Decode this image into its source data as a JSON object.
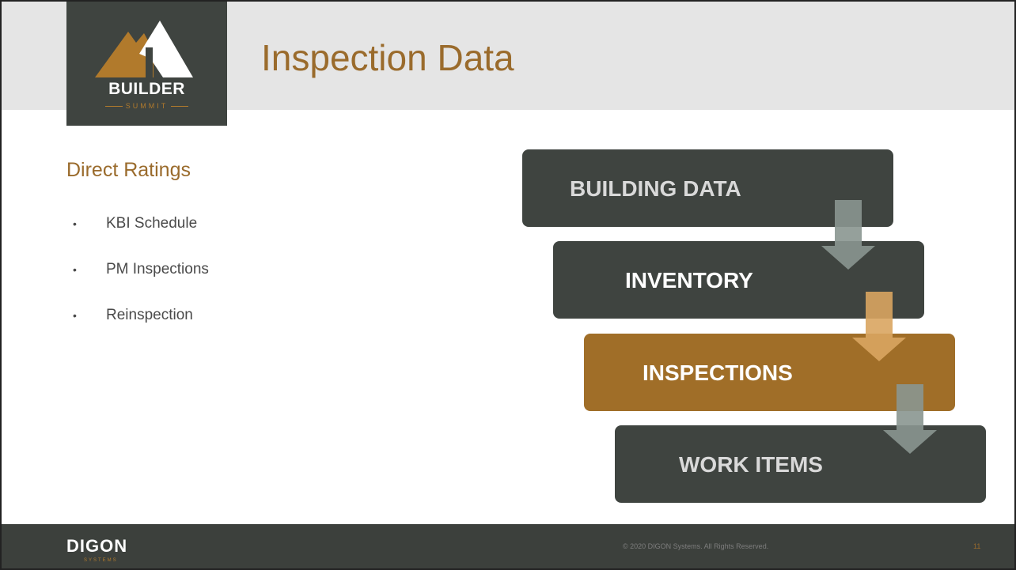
{
  "header": {
    "title": "Inspection Data",
    "logo_word": "BUILDER",
    "logo_sub": "SUMMIT"
  },
  "content": {
    "heading": "Direct Ratings",
    "bullets": [
      "KBI Schedule",
      "PM Inspections",
      "Reinspection"
    ]
  },
  "flow": {
    "steps": [
      {
        "label": "BUILDING DATA",
        "box_color": "#3f4440",
        "text_color": "#d9d9d9"
      },
      {
        "label": "INVENTORY",
        "box_color": "#3f4440",
        "text_color": "#ffffff"
      },
      {
        "label": "INSPECTIONS",
        "box_color": "#a06e28",
        "text_color": "#ffffff"
      },
      {
        "label": "WORK ITEMS",
        "box_color": "#3f4440",
        "text_color": "#d9d9d9"
      }
    ],
    "arrow_colors": [
      "#8a9690",
      "#d9a560",
      "#8a9690"
    ]
  },
  "footer": {
    "logo_word": "DIGON",
    "logo_sub": "SYSTEMS",
    "copyright": "© 2020 DIGON Systems. All Rights Reserved.",
    "page_number": "11"
  }
}
